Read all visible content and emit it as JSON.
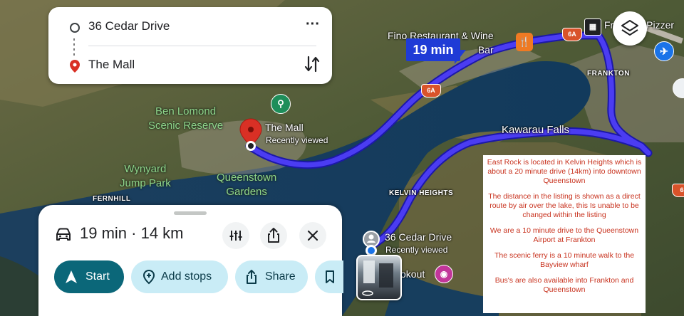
{
  "search": {
    "origin": "36 Cedar Drive",
    "destination": "The Mall"
  },
  "map": {
    "eta_badge": "19 min",
    "labels": {
      "ben_lomond": "Ben Lomond\nScenic Reserve",
      "wynyard": "Wynyard\nJump Park",
      "gardens": "Queenstown\nGardens",
      "fernhill": "FERNHILL",
      "the_mall": "The Mall",
      "the_mall_sub": "Recently viewed",
      "fino": "Fino Restaurant & Wine\nBar",
      "frankton_pizza": "Frankton Pizzer",
      "frankton": "FRANKTON",
      "kawarau": "Kawarau Falls",
      "kelvin": "KELVIN HEIGHTS",
      "cedar": "36 Cedar Drive",
      "cedar_sub": "Recently viewed",
      "lookout": "okout"
    },
    "route_shields": [
      "6A",
      "6A",
      "6"
    ],
    "colors": {
      "route": "#3a2bd8",
      "route_outline": "#1c18a8",
      "pin": "#d93025",
      "accent": "#0b6779"
    }
  },
  "sheet": {
    "summary": "19 min · 14 km",
    "buttons": {
      "start": "Start",
      "add_stops": "Add stops",
      "share": "Share"
    }
  },
  "note": {
    "paragraphs": [
      "East Rock is located in Kelvin Heights which is about a 20 minute drive (14km) into downtown Queenstown",
      "The distance in the listing is shown as a direct route by air over the lake, this Is unable to be changed within the listing",
      "We are a 10 minute drive to the Queenstown Airport at Frankton",
      "The scenic ferry is a 10 minute walk to the Bayview wharf",
      "Bus's are also available into Frankton and Queenstown"
    ]
  }
}
